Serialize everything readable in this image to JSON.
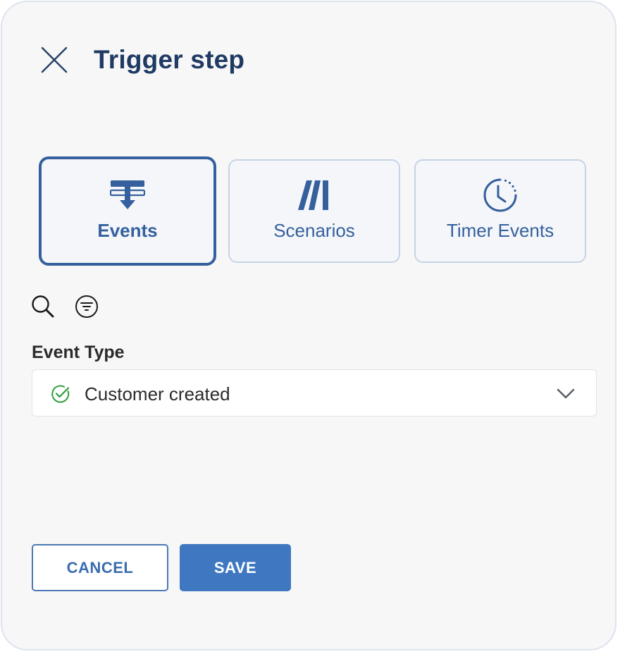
{
  "dialog": {
    "title": "Trigger step",
    "close_icon": "close-icon"
  },
  "trigger_types": [
    {
      "label": "Events",
      "icon": "events-icon",
      "selected": true
    },
    {
      "label": "Scenarios",
      "icon": "scenarios-icon",
      "selected": false
    },
    {
      "label": "Timer Events",
      "icon": "timer-icon",
      "selected": false
    }
  ],
  "tools": {
    "search_icon": "search-icon",
    "filter_icon": "filter-icon"
  },
  "event_type": {
    "label": "Event Type",
    "value": "Customer created",
    "status_icon": "check-circle-icon"
  },
  "actions": {
    "cancel_label": "CANCEL",
    "save_label": "SAVE"
  },
  "colors": {
    "accent": "#35609d",
    "primary_button": "#3f78c1",
    "title": "#1f3a63",
    "success": "#2e9d3a"
  }
}
